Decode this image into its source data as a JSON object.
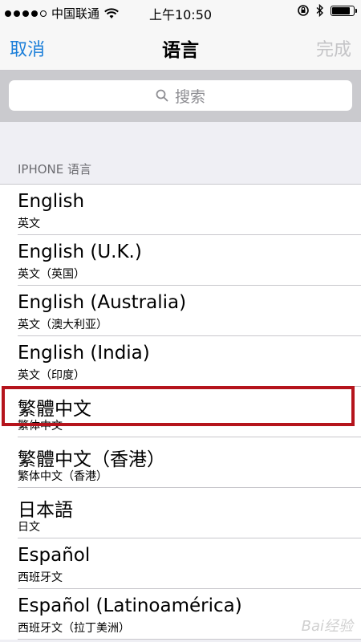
{
  "status_bar": {
    "carrier": "中国联通",
    "time": "上午10:50",
    "signal_bars_filled": 4,
    "signal_bars_total": 5,
    "battery_level": 0.85
  },
  "nav": {
    "cancel_label": "取消",
    "title": "语言",
    "done_label": "完成"
  },
  "search": {
    "placeholder": "搜索"
  },
  "section": {
    "header": "IPHONE 语言"
  },
  "languages": [
    {
      "name": "English",
      "native": "英文"
    },
    {
      "name": "English (U.K.)",
      "native": "英文（英国）"
    },
    {
      "name": "English (Australia)",
      "native": "英文（澳大利亚）"
    },
    {
      "name": "English (India)",
      "native": "英文（印度）"
    },
    {
      "name": "繁體中文",
      "native": "繁体中文"
    },
    {
      "name": "繁體中文（香港）",
      "native": "繁体中文（香港）"
    },
    {
      "name": "日本語",
      "native": "日文"
    },
    {
      "name": "Español",
      "native": "西班牙文"
    },
    {
      "name": "Español (Latinoamérica)",
      "native": "西班牙文（拉丁美洲）"
    }
  ],
  "colors": {
    "accent": "#1a7ed9",
    "highlight": "#b5141c"
  },
  "watermark": "Bai经验"
}
